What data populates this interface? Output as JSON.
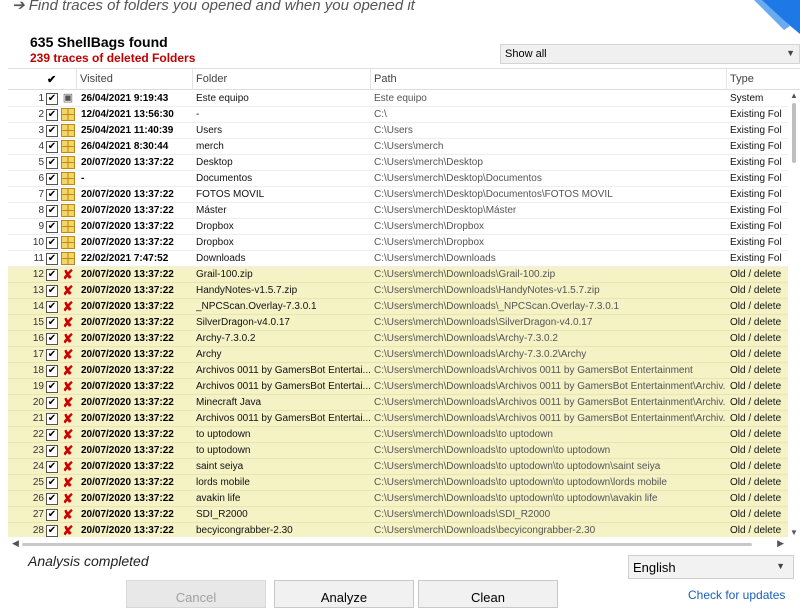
{
  "header": {
    "tagline": "➔ Find traces of folders you opened and when you opened it",
    "found": "635 ShellBags found",
    "deleted": "239 traces of deleted Folders",
    "filter": "Show all"
  },
  "columns": {
    "check": "✔",
    "visited": "Visited",
    "folder": "Folder",
    "path": "Path",
    "type": "Type"
  },
  "rows": [
    {
      "n": "1",
      "icon": "pc",
      "visited": "26/04/2021 9:19:43",
      "folder": "Este equipo",
      "path": "Este equipo",
      "type": "System",
      "deleted": false
    },
    {
      "n": "2",
      "icon": "folder",
      "visited": "12/04/2021 13:56:30",
      "folder": "-",
      "path": "C:\\",
      "type": "Existing Fol",
      "deleted": false
    },
    {
      "n": "3",
      "icon": "folder",
      "visited": "25/04/2021 11:40:39",
      "folder": "Users",
      "path": "C:\\Users",
      "type": "Existing Fol",
      "deleted": false
    },
    {
      "n": "4",
      "icon": "folder",
      "visited": "26/04/2021 8:30:44",
      "folder": "merch",
      "path": "C:\\Users\\merch",
      "type": "Existing Fol",
      "deleted": false
    },
    {
      "n": "5",
      "icon": "folder",
      "visited": "20/07/2020 13:37:22",
      "folder": "Desktop",
      "path": "C:\\Users\\merch\\Desktop",
      "type": "Existing Fol",
      "deleted": false
    },
    {
      "n": "6",
      "icon": "folder",
      "visited": "-",
      "folder": "Documentos",
      "path": "C:\\Users\\merch\\Desktop\\Documentos",
      "type": "Existing Fol",
      "deleted": false
    },
    {
      "n": "7",
      "icon": "folder",
      "visited": "20/07/2020 13:37:22",
      "folder": "FOTOS MÓVIL",
      "path": "C:\\Users\\merch\\Desktop\\Documentos\\FOTOS MÓVIL",
      "type": "Existing Fol",
      "deleted": false
    },
    {
      "n": "8",
      "icon": "folder",
      "visited": "20/07/2020 13:37:22",
      "folder": "Máster",
      "path": "C:\\Users\\merch\\Desktop\\Máster",
      "type": "Existing Fol",
      "deleted": false
    },
    {
      "n": "9",
      "icon": "folder",
      "visited": "20/07/2020 13:37:22",
      "folder": "Dropbox",
      "path": "C:\\Users\\merch\\Dropbox",
      "type": "Existing Fol",
      "deleted": false
    },
    {
      "n": "10",
      "icon": "folder",
      "visited": "20/07/2020 13:37:22",
      "folder": "Dropbox",
      "path": "C:\\Users\\merch\\Dropbox",
      "type": "Existing Fol",
      "deleted": false
    },
    {
      "n": "11",
      "icon": "folder",
      "visited": "22/02/2021 7:47:52",
      "folder": "Downloads",
      "path": "C:\\Users\\merch\\Downloads",
      "type": "Existing Fol",
      "deleted": false
    },
    {
      "n": "12",
      "icon": "del",
      "visited": "20/07/2020 13:37:22",
      "folder": "Grail-100.zip",
      "path": "C:\\Users\\merch\\Downloads\\Grail-100.zip",
      "type": "Old / delete",
      "deleted": true
    },
    {
      "n": "13",
      "icon": "del",
      "visited": "20/07/2020 13:37:22",
      "folder": "HandyNotes-v1.5.7.zip",
      "path": "C:\\Users\\merch\\Downloads\\HandyNotes-v1.5.7.zip",
      "type": "Old / delete",
      "deleted": true
    },
    {
      "n": "14",
      "icon": "del",
      "visited": "20/07/2020 13:37:22",
      "folder": "_NPCScan.Overlay-7.3.0.1",
      "path": "C:\\Users\\merch\\Downloads\\_NPCScan.Overlay-7.3.0.1",
      "type": "Old / delete",
      "deleted": true
    },
    {
      "n": "15",
      "icon": "del",
      "visited": "20/07/2020 13:37:22",
      "folder": "SilverDragon-v4.0.17",
      "path": "C:\\Users\\merch\\Downloads\\SilverDragon-v4.0.17",
      "type": "Old / delete",
      "deleted": true
    },
    {
      "n": "16",
      "icon": "del",
      "visited": "20/07/2020 13:37:22",
      "folder": "Archy-7.3.0.2",
      "path": "C:\\Users\\merch\\Downloads\\Archy-7.3.0.2",
      "type": "Old / delete",
      "deleted": true
    },
    {
      "n": "17",
      "icon": "del",
      "visited": "20/07/2020 13:37:22",
      "folder": "Archy",
      "path": "C:\\Users\\merch\\Downloads\\Archy-7.3.0.2\\Archy",
      "type": "Old / delete",
      "deleted": true
    },
    {
      "n": "18",
      "icon": "del",
      "visited": "20/07/2020 13:37:22",
      "folder": "Archivos 0011 by GamersBot Entertai...",
      "path": "C:\\Users\\merch\\Downloads\\Archivos 0011 by GamersBot Entertainment",
      "type": "Old / delete",
      "deleted": true
    },
    {
      "n": "19",
      "icon": "del",
      "visited": "20/07/2020 13:37:22",
      "folder": "Archivos 0011 by GamersBot Entertai...",
      "path": "C:\\Users\\merch\\Downloads\\Archivos 0011 by GamersBot Entertainment\\Archiv...",
      "type": "Old / delete",
      "deleted": true
    },
    {
      "n": "20",
      "icon": "del",
      "visited": "20/07/2020 13:37:22",
      "folder": "Minecraft   Java",
      "path": "C:\\Users\\merch\\Downloads\\Archivos 0011 by GamersBot Entertainment\\Archiv...",
      "type": "Old / delete",
      "deleted": true
    },
    {
      "n": "21",
      "icon": "del",
      "visited": "20/07/2020 13:37:22",
      "folder": "Archivos 0011 by GamersBot Entertai...",
      "path": "C:\\Users\\merch\\Downloads\\Archivos 0011 by GamersBot Entertainment\\Archiv...",
      "type": "Old / delete",
      "deleted": true
    },
    {
      "n": "22",
      "icon": "del",
      "visited": "20/07/2020 13:37:22",
      "folder": "to uptodown",
      "path": "C:\\Users\\merch\\Downloads\\to uptodown",
      "type": "Old / delete",
      "deleted": true
    },
    {
      "n": "23",
      "icon": "del",
      "visited": "20/07/2020 13:37:22",
      "folder": "to uptodown",
      "path": "C:\\Users\\merch\\Downloads\\to uptodown\\to uptodown",
      "type": "Old / delete",
      "deleted": true
    },
    {
      "n": "24",
      "icon": "del",
      "visited": "20/07/2020 13:37:22",
      "folder": "saint seiya",
      "path": "C:\\Users\\merch\\Downloads\\to uptodown\\to uptodown\\saint seiya",
      "type": "Old / delete",
      "deleted": true
    },
    {
      "n": "25",
      "icon": "del",
      "visited": "20/07/2020 13:37:22",
      "folder": "lords mobile",
      "path": "C:\\Users\\merch\\Downloads\\to uptodown\\to uptodown\\lords mobile",
      "type": "Old / delete",
      "deleted": true
    },
    {
      "n": "26",
      "icon": "del",
      "visited": "20/07/2020 13:37:22",
      "folder": "avakin life",
      "path": "C:\\Users\\merch\\Downloads\\to uptodown\\to uptodown\\avakin life",
      "type": "Old / delete",
      "deleted": true
    },
    {
      "n": "27",
      "icon": "del",
      "visited": "20/07/2020 13:37:22",
      "folder": "SDI_R2000",
      "path": "C:\\Users\\merch\\Downloads\\SDI_R2000",
      "type": "Old / delete",
      "deleted": true
    },
    {
      "n": "28",
      "icon": "del",
      "visited": "20/07/2020 13:37:22",
      "folder": "becyicongrabber-2.30",
      "path": "C:\\Users\\merch\\Downloads\\becyicongrabber-2.30",
      "type": "Old / delete",
      "deleted": true
    }
  ],
  "footer": {
    "status": "Analysis completed",
    "language": "English",
    "cancel": "Cancel",
    "analyze": "Analyze",
    "clean": "Clean",
    "updates": "Check for updates"
  },
  "colors": {
    "deleted_text": "#c00000",
    "deleted_row": "#f5f2c6",
    "link": "#1a5fb4",
    "logo": "#1e78e6"
  }
}
